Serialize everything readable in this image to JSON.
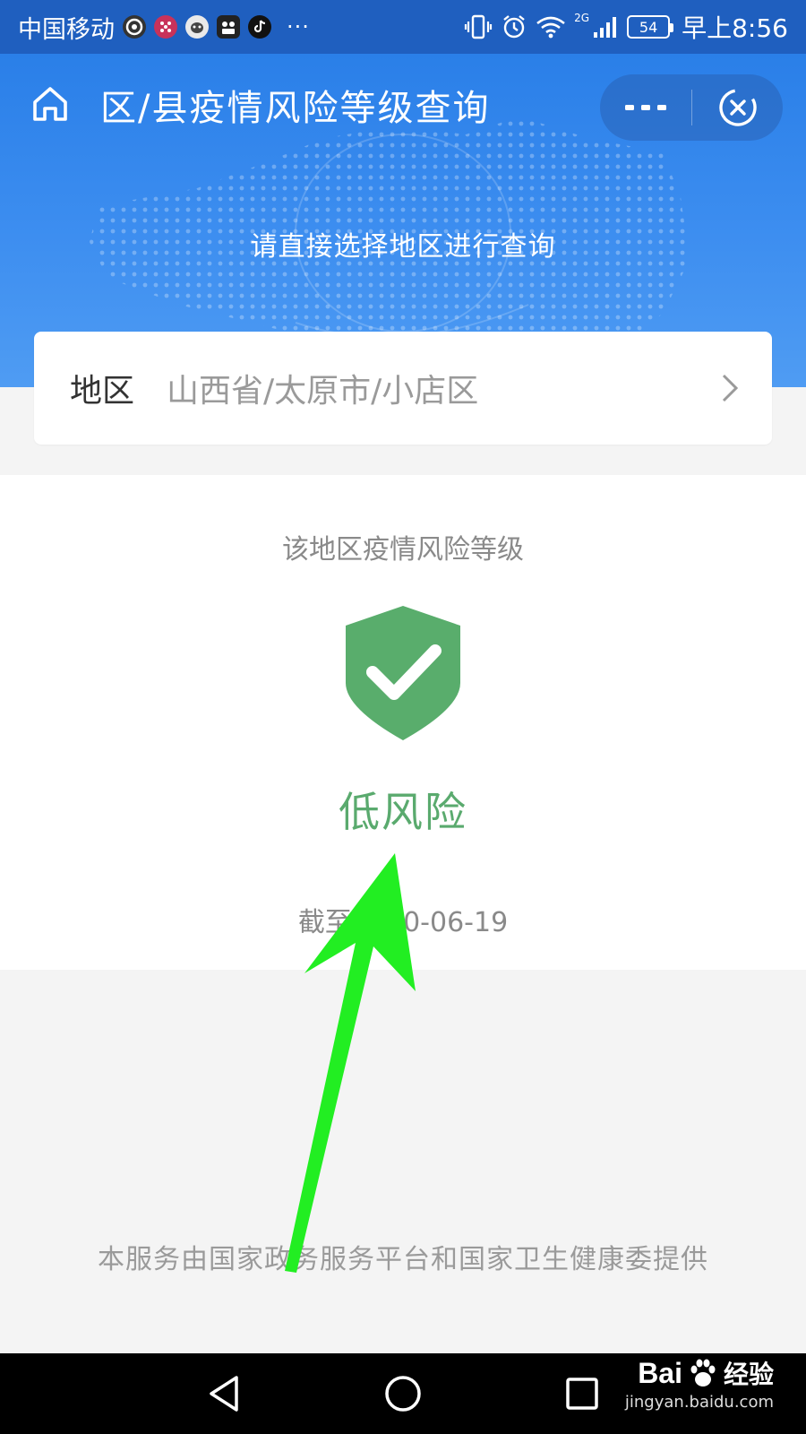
{
  "status_bar": {
    "carrier": "中国移动",
    "more": "···",
    "network": "2G",
    "battery": "54",
    "time": "早上8:56"
  },
  "header": {
    "title": "区/县疫情风险等级查询",
    "subtitle": "请直接选择地区进行查询",
    "home_icon": "home-icon",
    "more_icon": "more-dots-icon",
    "close_icon": "target-close-icon"
  },
  "region": {
    "label": "地区",
    "value": "山西省/太原市/小店区"
  },
  "result": {
    "label": "该地区疫情风险等级",
    "level": "低风险",
    "as_of": "截至2020-06-19",
    "level_color": "#5aaa6e",
    "shield_color": "#59ad6c"
  },
  "footer": {
    "note": "本服务由国家政务服务平台和国家卫生健康委提供"
  },
  "watermark": {
    "brand": "Bai",
    "brand_tail": "经验",
    "url": "jingyan.baidu.com"
  },
  "colors": {
    "header_blue": "#2a7fe8",
    "status_blue": "#1f5fbf",
    "arrow_green": "#22ee22"
  }
}
